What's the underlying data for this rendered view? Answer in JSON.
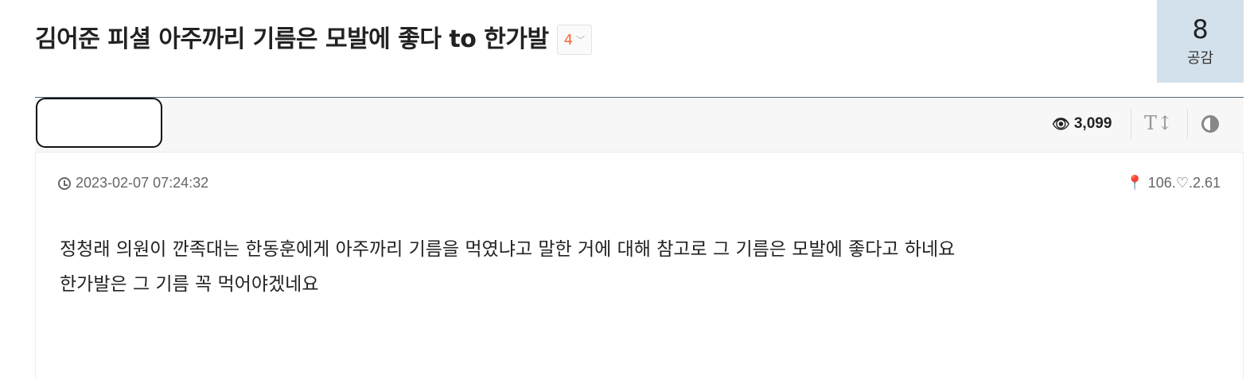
{
  "post": {
    "title": "김어준 피셜 아주까리 기름은 모발에 좋다 to 한가발",
    "comment_count": "4",
    "upvotes": "8",
    "upvote_label": "공감",
    "views": "3,099",
    "date": "2023-02-07 07:24:32",
    "ip": "106.♡.2.61",
    "body_lines": [
      "정청래 의원이 깐족대는 한동훈에게 아주까리 기름을 먹였냐고 말한 거에 대해 참고로 그 기름은 모발에 좋다고 하네요",
      "한가발은 그 기름 꼭 먹어야겠네요"
    ]
  },
  "icons": {
    "views": "eye-icon",
    "font_size": "text-size-icon",
    "theme": "contrast-icon",
    "date": "clock-icon",
    "ip": "map-pin-icon",
    "dropdown": "chevron-down-icon"
  },
  "colors": {
    "comment_count": "#ff6633",
    "upvote_bg": "#d3e1ec",
    "toolbar_bg": "#f7f7f7"
  }
}
